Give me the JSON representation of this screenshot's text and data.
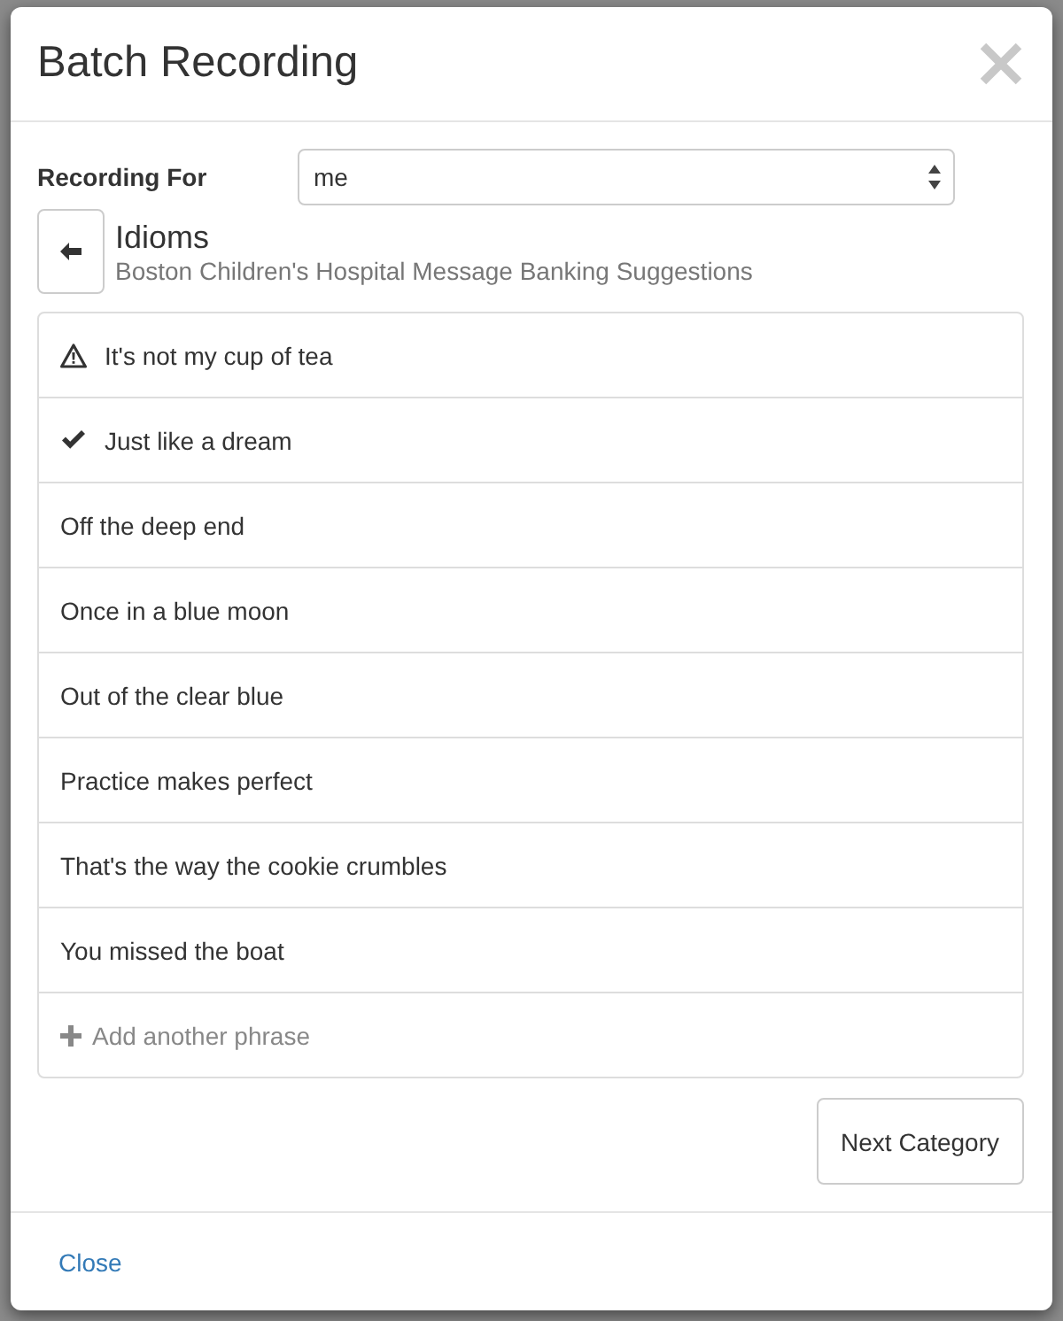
{
  "dialog": {
    "title": "Batch Recording"
  },
  "recording_for": {
    "label": "Recording For",
    "value": "me"
  },
  "category": {
    "title": "Idioms",
    "subtitle": "Boston Children's Hospital Message Banking Suggestions"
  },
  "phrases": [
    {
      "text": "It's not my cup of tea",
      "kind": "warning"
    },
    {
      "text": "Just like a dream",
      "kind": "checked"
    },
    {
      "text": "Off the deep end",
      "kind": "plain"
    },
    {
      "text": "Once in a blue moon",
      "kind": "plain"
    },
    {
      "text": "Out of the clear blue",
      "kind": "plain"
    },
    {
      "text": "Practice makes perfect",
      "kind": "plain"
    },
    {
      "text": "That's the way the cookie crumbles",
      "kind": "plain"
    },
    {
      "text": "You missed the boat",
      "kind": "plain"
    }
  ],
  "add_phrase": {
    "label": "Add another phrase"
  },
  "next_button": {
    "label": "Next Category"
  },
  "footer": {
    "close_link": "Close"
  }
}
